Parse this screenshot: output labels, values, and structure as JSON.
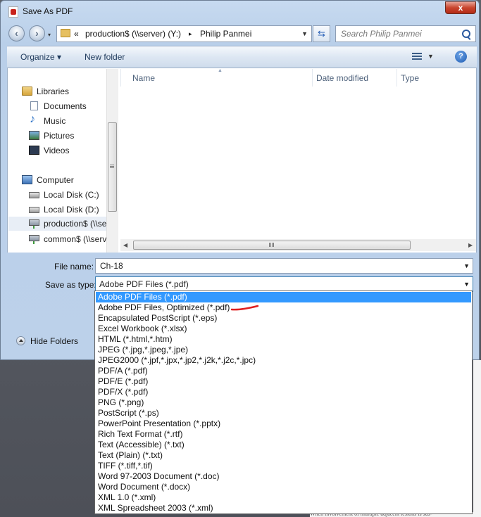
{
  "window": {
    "title": "Save As PDF",
    "close_glyph": "x"
  },
  "address": {
    "prefix": "«",
    "segments": [
      "production$ (\\\\server) (Y:)",
      "Philip Panmei"
    ],
    "separator": "▸"
  },
  "search": {
    "placeholder": "Search Philip Panmei"
  },
  "toolbar": {
    "organize": "Organize ▾",
    "new_folder": "New folder",
    "help": "?"
  },
  "sidebar": {
    "items": [
      {
        "label": "Libraries",
        "icon": "libraries-icon"
      },
      {
        "label": "Documents",
        "icon": "documents-icon"
      },
      {
        "label": "Music",
        "icon": "music-icon"
      },
      {
        "label": "Pictures",
        "icon": "pictures-icon"
      },
      {
        "label": "Videos",
        "icon": "videos-icon"
      },
      {
        "label": "Computer",
        "icon": "computer-icon"
      },
      {
        "label": "Local Disk (C:)",
        "icon": "disk-icon"
      },
      {
        "label": "Local Disk (D:)",
        "icon": "disk-icon"
      },
      {
        "label": "production$ (\\\\se",
        "icon": "network-drive-icon"
      },
      {
        "label": "common$ (\\\\serv",
        "icon": "network-drive-icon"
      }
    ]
  },
  "columns": [
    "Name",
    "Date modified",
    "Type"
  ],
  "form": {
    "file_name_label": "File name:",
    "file_name_value": "Ch-18",
    "save_type_label": "Save as type:",
    "save_type_value": "Adobe PDF Files (*.pdf)"
  },
  "hide_folders": "Hide Folders",
  "type_options": [
    "Adobe PDF Files (*.pdf)",
    "Adobe PDF Files, Optimized (*.pdf)",
    "Encapsulated PostScript (*.eps)",
    "Excel Workbook (*.xlsx)",
    "HTML (*.html,*.htm)",
    "JPEG (*.jpg,*.jpeg,*.jpe)",
    "JPEG2000 (*.jpf,*.jpx,*.jp2,*.j2k,*.j2c,*.jpc)",
    "PDF/A (*.pdf)",
    "PDF/E (*.pdf)",
    "PDF/X (*.pdf)",
    "PNG (*.png)",
    "PostScript (*.ps)",
    "PowerPoint Presentation (*.pptx)",
    "Rich Text Format (*.rtf)",
    "Text (Accessible) (*.txt)",
    "Text (Plain) (*.txt)",
    "TIFF (*.tiff,*.tif)",
    "Word 97-2003 Document (*.doc)",
    "Word Document (*.docx)",
    "XML 1.0 (*.xml)",
    "XML Spreadsheet 2003 (*.xml)"
  ],
  "selected_option_index": 0,
  "background_text": "When involvement of multiple adjacent lesions is sus-",
  "colors": {
    "selection": "#3399ff",
    "annotation": "#e02020",
    "close": "#c9452e"
  }
}
